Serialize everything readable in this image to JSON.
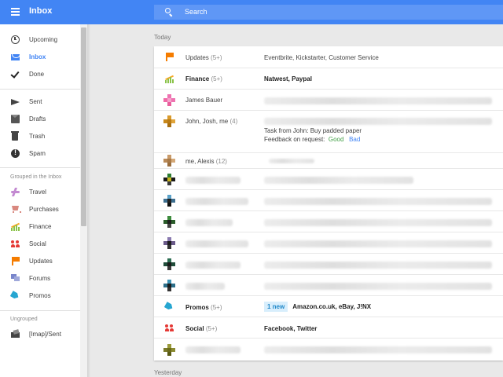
{
  "app": {
    "title": "Inbox",
    "accent": "#4285f4"
  },
  "search": {
    "placeholder": "Search"
  },
  "sidebar": {
    "primary": [
      {
        "id": "upcoming",
        "label": "Upcoming",
        "icon": "clock-icon"
      },
      {
        "id": "inbox",
        "label": "Inbox",
        "icon": "inbox-icon",
        "active": true
      },
      {
        "id": "done",
        "label": "Done",
        "icon": "check-icon"
      }
    ],
    "secondary": [
      {
        "id": "sent",
        "label": "Sent",
        "icon": "send-icon"
      },
      {
        "id": "drafts",
        "label": "Drafts",
        "icon": "drafts-icon"
      },
      {
        "id": "trash",
        "label": "Trash",
        "icon": "trash-icon"
      },
      {
        "id": "spam",
        "label": "Spam",
        "icon": "spam-icon"
      }
    ],
    "grouped_label": "Grouped in the Inbox",
    "grouped": [
      {
        "id": "travel",
        "label": "Travel",
        "icon": "travel-icon"
      },
      {
        "id": "purchases",
        "label": "Purchases",
        "icon": "cart-icon"
      },
      {
        "id": "finance",
        "label": "Finance",
        "icon": "finance-icon"
      },
      {
        "id": "social",
        "label": "Social",
        "icon": "social-icon"
      },
      {
        "id": "updates",
        "label": "Updates",
        "icon": "flag-icon"
      },
      {
        "id": "forums",
        "label": "Forums",
        "icon": "forums-icon"
      },
      {
        "id": "promos",
        "label": "Promos",
        "icon": "tag-icon"
      }
    ],
    "ungrouped_label": "Ungrouped",
    "ungrouped": [
      {
        "id": "imap-sent",
        "label": "[Imap]/Sent",
        "icon": "imap-folder-icon"
      }
    ]
  },
  "sections": {
    "today": "Today",
    "yesterday": "Yesterday"
  },
  "rows": {
    "updates": {
      "sender": "Updates",
      "count": "(5+)",
      "summary": "Eventbrite, Kickstarter, Customer Service"
    },
    "finance": {
      "sender": "Finance",
      "count": "(5+)",
      "summary": "Natwest, Paypal"
    },
    "james": {
      "sender": "James Bauer"
    },
    "john": {
      "sender": "John, Josh, me",
      "count": "(4)",
      "task": "Task from John: Buy padded paper",
      "feedback": "Feedback on request:",
      "good": "Good",
      "bad": "Bad"
    },
    "alexis": {
      "sender": "me, Alexis",
      "count": "(12)"
    },
    "promos": {
      "sender": "Promos",
      "count": "(5+)",
      "badge": "1 new",
      "summary": "Amazon.co.uk, eBay, J!NX"
    },
    "social": {
      "sender": "Social",
      "count": "(5+)",
      "summary": "Facebook, Twitter"
    }
  }
}
